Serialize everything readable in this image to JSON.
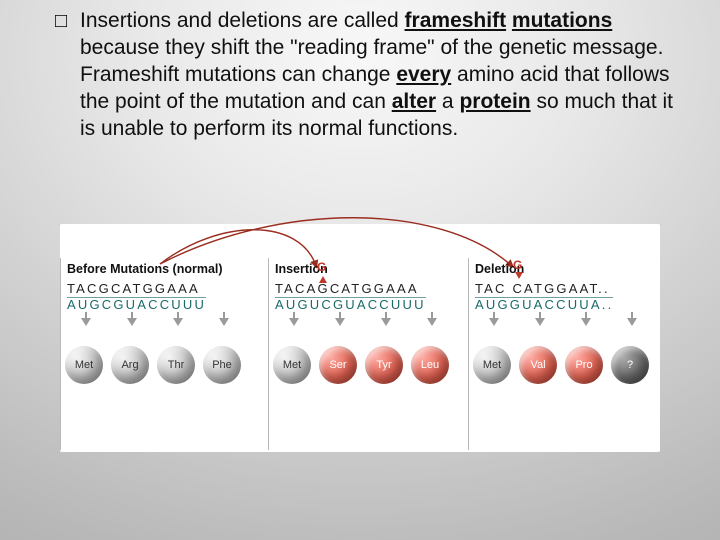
{
  "text": {
    "bullet": "□",
    "lead": " Insertions and deletions are called ",
    "frameshift": "frameshift",
    "mutations_sp": "mutations ",
    "mid1": "because they shift the \"reading frame\" of the genetic message. Frameshift mutations can change ",
    "every": "every",
    "mid2": " amino acid that follows the point of the mutation and can ",
    "alter": "alter",
    "mid3": " a ",
    "protein": "protein",
    "tail": " so much that it is unable to perform its normal functions."
  },
  "panels": {
    "normal": {
      "title": "Before Mutations (normal)",
      "dna": "TACGCATGGAAA",
      "rna": "AUGCGUACCUUU",
      "aa": [
        "Met",
        "Arg",
        "Thr",
        "Phe"
      ],
      "colors": [
        "grey",
        "grey",
        "grey",
        "grey"
      ]
    },
    "insertion": {
      "title": "Insertion",
      "dna": "TACAGCATGGAAA",
      "rna": "AUGUCGUACCUUU",
      "aa": [
        "Met",
        "Ser",
        "Tyr",
        "Leu"
      ],
      "colors": [
        "grey",
        "red",
        "red",
        "red"
      ],
      "ins_letter": "G"
    },
    "deletion": {
      "title": "Deletion",
      "dna": "TAC CATGGAAT..",
      "rna": "AUGGUACCUUA..",
      "aa": [
        "Met",
        "Val",
        "Pro",
        "?"
      ],
      "colors": [
        "grey",
        "red",
        "red",
        "dark"
      ],
      "del_letter": "G"
    }
  }
}
